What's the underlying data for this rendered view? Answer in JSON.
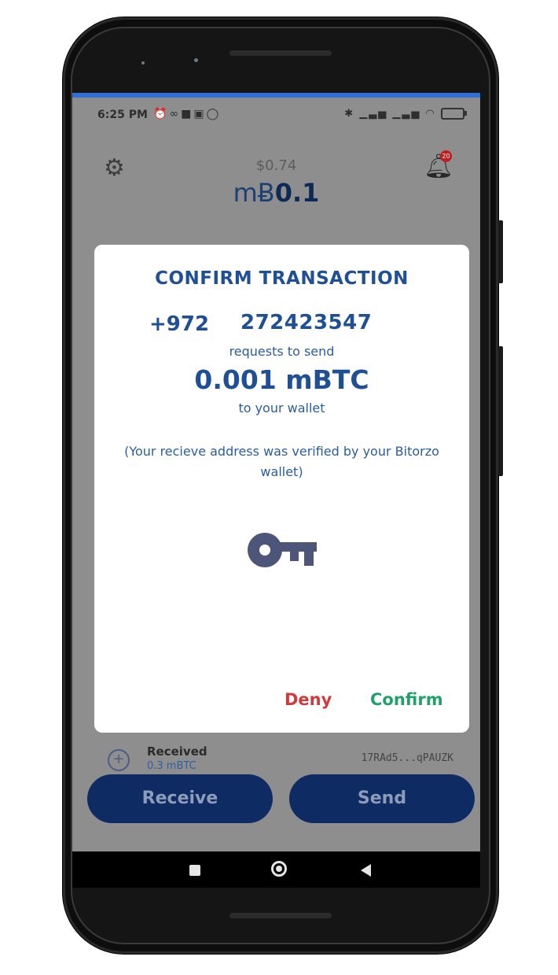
{
  "status_bar": {
    "time": "6:25 PM",
    "battery": "19"
  },
  "wallet": {
    "fiat_balance": "$0.74",
    "currency_prefix": "mɃ",
    "balance": "0.1",
    "notification_count": "20"
  },
  "transaction": {
    "label": "Received",
    "amount": "0.3 mBTC",
    "address": "17RAd5...qPAUZK"
  },
  "actions": {
    "receive_label": "Receive",
    "send_label": "Send"
  },
  "dialog": {
    "title": "CONFIRM TRANSACTION",
    "country_code": "+972",
    "phone_number": "272423547",
    "requests_text": "requests to send",
    "amount": "0.001 mBTC",
    "to_wallet_text": "to your wallet",
    "note": "(Your recieve address was verified by your Bitorzo wallet)",
    "deny_label": "Deny",
    "confirm_label": "Confirm"
  },
  "colors": {
    "accent_blue": "#1f4f95",
    "deny_red": "#d03a3a",
    "confirm_green": "#22a06a",
    "pill_navy": "#0e2b63"
  },
  "icons": {
    "settings": "gear-icon",
    "notifications": "bell-icon",
    "key": "key-icon",
    "received": "plus-circle-icon"
  }
}
